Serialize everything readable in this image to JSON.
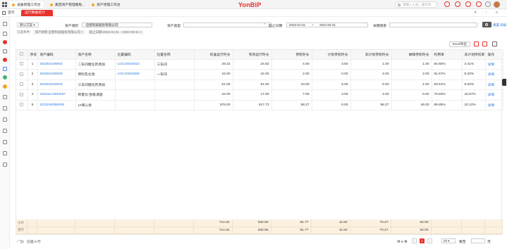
{
  "topbar": {
    "brand": "YonBIP",
    "apps": [
      "设备管理工作台",
      "集团资产管理看板…",
      "资产经理工作台"
    ],
    "search_placeholder": "请输入人员、服务等"
  },
  "tabs": {
    "home": "首页",
    "open_tab": "运行数据统计"
  },
  "filter": {
    "scheme": "默认方案",
    "asset_org_label": "资产组织",
    "asset_org_value": "启智科技股份有限公司",
    "asset_type_label": "资产类型",
    "date_label": "起止日期",
    "date_start": "2023-01-01",
    "date_sep": "~",
    "date_end": "2024-03-31",
    "keyword_label": "关键搜索",
    "reset": "重置",
    "more": "高级",
    "chips_prefix": "已选条件：",
    "chip_org": "资产组织:启智科技股份有限公司",
    "chip_date": "起止日期:2023-01-01 ~ 2024-03-31"
  },
  "toolbar": {
    "excel": "Excel导出"
  },
  "table": {
    "headers": [
      "序号",
      "资产编码",
      "资产名称",
      "位置编码",
      "位置名称",
      "标准运行时长",
      "有效运行时长",
      "停机时长",
      "计划停机时长",
      "非计划停机时长",
      "故障停机时长",
      "利用率",
      "非计划停机率",
      "操作"
    ],
    "rows": [
      {
        "no": "1",
        "code": "202302190002",
        "name": "二车间催化剂添加",
        "loc_code": "LOC23020010",
        "loc_name": "三车间",
        "std": "29.32",
        "eff": "24.82",
        "stop": "4.50",
        "plan": "3.50",
        "unplan": "1.00",
        "fault": "1.00",
        "util": "84.65%",
        "rate": "3.41%",
        "op": "详情"
      },
      {
        "no": "2",
        "code": "202302190006",
        "name": "原料乳化泵",
        "loc_code": "LOC23020008",
        "loc_name": "一车间",
        "std": "24.00",
        "eff": "22.00",
        "stop": "2.00",
        "plan": "0.00",
        "unplan": "2.00",
        "fault": "2.00",
        "util": "91.67%",
        "rate": "8.33%",
        "op": "详情"
      },
      {
        "no": "3",
        "code": "202302240025",
        "name": "三车间催化剂添加",
        "loc_code": "",
        "loc_name": "",
        "std": "61.00",
        "eff": "51.00",
        "stop": "10.00",
        "plan": "5.00",
        "unplan": "5.00",
        "fault": "1.00",
        "util": "83.61%",
        "rate": "8.20%",
        "op": "详情"
      },
      {
        "no": "4",
        "code": "230411C0M0037",
        "name": "称量仪-刮板调速",
        "loc_code": "",
        "loc_name": "",
        "std": "24.00",
        "eff": "17.00",
        "stop": "7.00",
        "plan": "3.00",
        "unplan": "4.00",
        "fault": "0.00",
        "util": "70.83%",
        "rate": "16.67%",
        "op": "详情"
      },
      {
        "no": "5",
        "code": "2312040055000",
        "name": "1#离心泵",
        "loc_code": "",
        "loc_name": "",
        "std": "576.00",
        "eff": "517.73",
        "stop": "58.27",
        "plan": "0.00",
        "unplan": "58.27",
        "fault": "46.00",
        "util": "89.88%",
        "rate": "10.12%",
        "op": "详情"
      }
    ]
  },
  "summary": {
    "subtotal_label": "小计",
    "total_label": "合计",
    "std": "714.32",
    "eff": "632.55",
    "stop": "81.77",
    "plan": "11.50",
    "unplan": "70.27",
    "fault": "52.00"
  },
  "footer": {
    "selected": "已选 0 行",
    "total": "共 5 条",
    "page": "1",
    "page_size": "20",
    "goto_label": "跳至",
    "page_unit": "页"
  },
  "colors": {
    "brand": "#e8322a",
    "link": "#2a7ae2",
    "summary_bg": "#fbf1e1"
  }
}
